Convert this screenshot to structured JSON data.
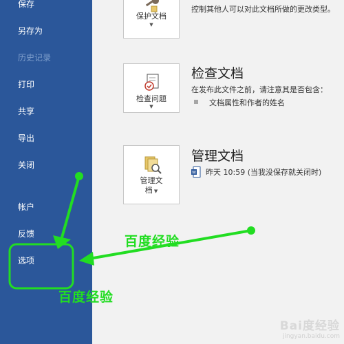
{
  "sidebar": {
    "items": [
      {
        "label": "保存",
        "enabled": true
      },
      {
        "label": "另存为",
        "enabled": true
      },
      {
        "label": "历史记录",
        "enabled": false
      },
      {
        "label": "打印",
        "enabled": true
      },
      {
        "label": "共享",
        "enabled": true
      },
      {
        "label": "导出",
        "enabled": true
      },
      {
        "label": "关闭",
        "enabled": true
      },
      {
        "label": "帐户",
        "enabled": true
      },
      {
        "label": "反馈",
        "enabled": true
      },
      {
        "label": "选项",
        "enabled": true
      }
    ]
  },
  "protect": {
    "button_label": "保护文档",
    "description": "控制其他人可以对此文档所做的更改类型。"
  },
  "inspect": {
    "title": "检查文档",
    "button_label": "检查问题",
    "description": "在发布此文件之前，请注意其是否包含：",
    "bullet": "文档属性和作者的姓名"
  },
  "manage": {
    "title": "管理文档",
    "button_label_line1": "管理文",
    "button_label_line2": "档",
    "version": "昨天 10:59 (当我没保存就关闭时)"
  },
  "annotations": {
    "label1": "百度经验",
    "label2": "百度经验",
    "color": "#22dd22"
  },
  "watermark": {
    "brand": "Bai度经验",
    "url": "jingyan.baidu.com"
  },
  "colors": {
    "sidebar": "#2b579a",
    "background": "#f2f2f2"
  }
}
